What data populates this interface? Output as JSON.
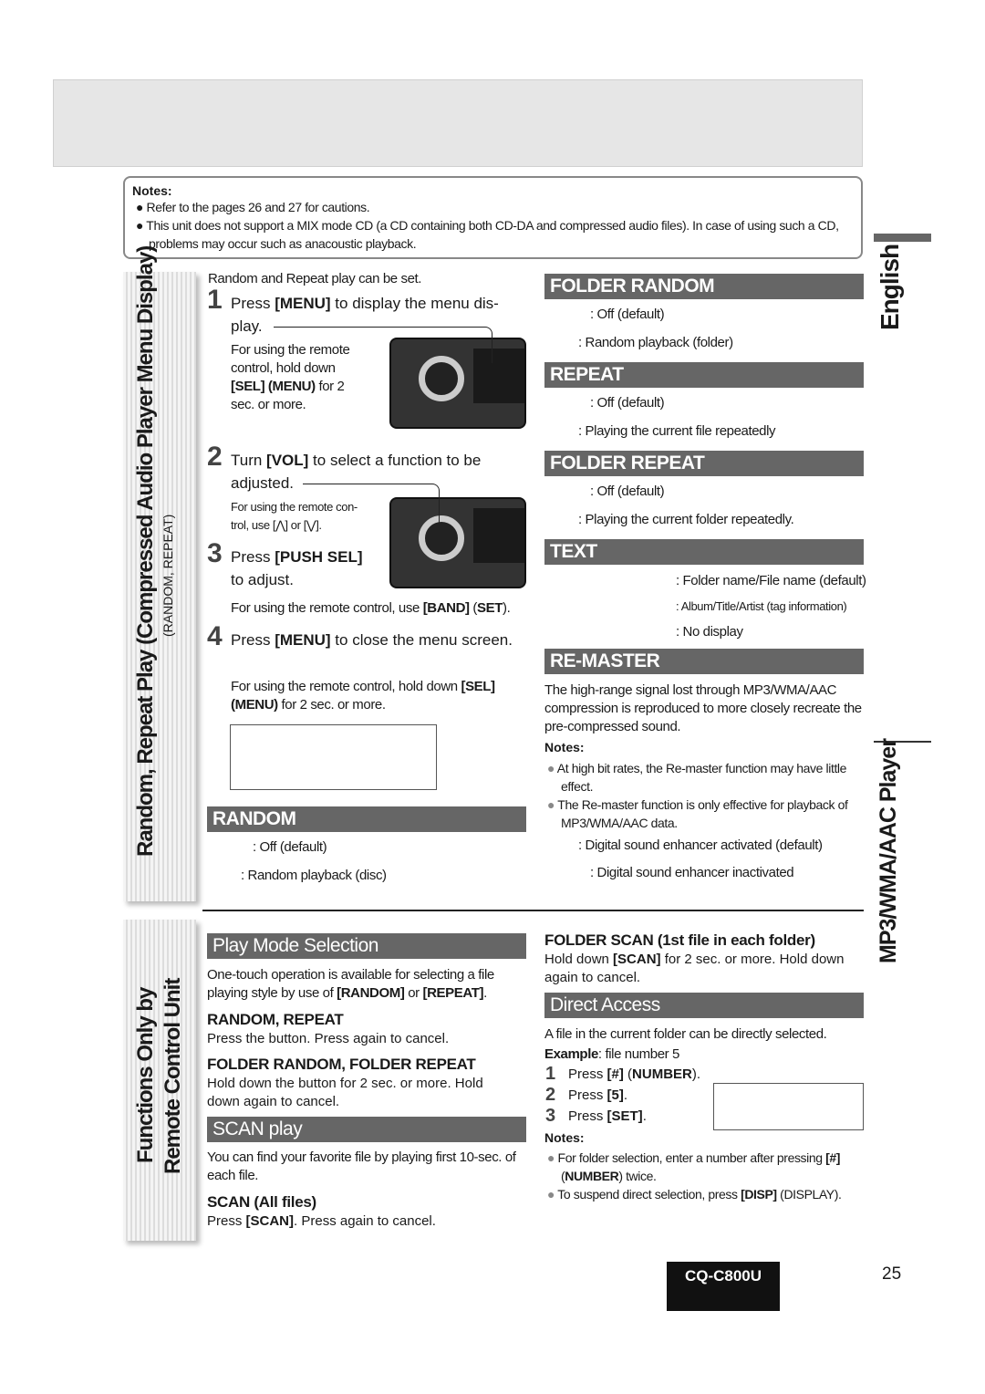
{
  "notes_top": {
    "title": "Notes:",
    "items": [
      "Refer to the pages 26 and 27 for cautions.",
      "This unit does not support a MIX mode CD (a CD containing both CD-DA and compressed audio files). In case of using such a CD, problems may occur such as anacoustic playback."
    ]
  },
  "side": {
    "title1": "Random, Repeat Play (Compressed Audio Player Menu Display)",
    "sub1": "(RANDOM, REPEAT)",
    "title2a": "Functions Only by",
    "title2b": "Remote Control Unit",
    "lang": "English",
    "product": "MP3/WMA/AAC Player"
  },
  "intro": "Random and Repeat play can be set.",
  "steps": [
    {
      "n": "1",
      "pre": "Press ",
      "key": "[MENU]",
      "post": " to display the menu dis- play.",
      "note_pre": "For using the remote control, hold down ",
      "note_key": "[SEL] (MENU)",
      "note_post": " for 2 sec. or more."
    },
    {
      "n": "2",
      "pre": "Turn ",
      "key": "[VOL]",
      "post": " to select a function to be adjusted.",
      "note": "For using the remote con- trol, use [⋀] or [⋁]."
    },
    {
      "n": "3",
      "pre": "Press ",
      "key": "[PUSH SEL]",
      "post": " to adjust.",
      "note_pre": "For using the remote control, use ",
      "note_key": "[BAND]",
      "note_mid": " (",
      "note_key2": "SET",
      "note_post": ")."
    },
    {
      "n": "4",
      "pre": "Press ",
      "key": "[MENU]",
      "post": " to close the menu screen.",
      "note_pre": "For using the remote control, hold down ",
      "note_key": "[SEL] (MENU)",
      "note_post": " for 2 sec. or more."
    }
  ],
  "random": {
    "title": "RANDOM",
    "opts": [
      ": Off (default)",
      ": Random playback (disc)"
    ]
  },
  "folder_random": {
    "title": "FOLDER RANDOM",
    "opts": [
      ": Off (default)",
      ": Random playback (folder)"
    ]
  },
  "repeat": {
    "title": "REPEAT",
    "opts": [
      ": Off (default)",
      ": Playing the current file repeatedly"
    ]
  },
  "folder_repeat": {
    "title": "FOLDER REPEAT",
    "opts": [
      ": Off (default)",
      ": Playing the current folder repeatedly."
    ]
  },
  "text": {
    "title": "TEXT",
    "opts": [
      ": Folder name/File name (default)",
      ": Album/Title/Artist (tag information)",
      ": No display"
    ]
  },
  "remaster": {
    "title": "RE-MASTER",
    "desc": "The high-range signal lost through MP3/WMA/AAC compression is reproduced to more closely recreate the pre-compressed sound.",
    "notes_title": "Notes:",
    "notes": [
      "At high bit rates, the Re-master function may have little effect.",
      "The Re-master function is only effective for playback of MP3/WMA/AAC data."
    ],
    "opts": [
      ": Digital sound enhancer activated (default)",
      ": Digital sound enhancer inactivated"
    ]
  },
  "play_mode": {
    "title": "Play Mode Selection",
    "desc_pre": "One-touch operation is available for selecting a file playing style by use of ",
    "k1": "[RANDOM]",
    "mid": " or ",
    "k2": "[REPEAT]",
    "desc_post": ".",
    "s1": "RANDOM, REPEAT",
    "s1_text": "Press the button. Press again to cancel.",
    "s2": "FOLDER RANDOM, FOLDER REPEAT",
    "s2_text": "Hold down the button for 2 sec. or more. Hold down again to cancel."
  },
  "scan": {
    "title": "SCAN play",
    "desc": "You can find your favorite file by playing first 10-sec. of each file.",
    "s1": "SCAN (All files)",
    "s1_pre": "Press ",
    "s1_key": "[SCAN]",
    "s1_post": ". Press again to cancel.",
    "s2": "FOLDER SCAN (1st file in each folder)",
    "s2_pre": "Hold down ",
    "s2_key": "[SCAN]",
    "s2_post": " for 2 sec. or more. Hold down again to cancel."
  },
  "direct": {
    "title": "Direct Access",
    "desc": "A file in the current folder can be directly selected.",
    "ex_label": "Example",
    "ex_text": ": file number 5",
    "steps": [
      {
        "n": "1",
        "pre": "Press ",
        "key": "[#]",
        "mid": " (",
        "key2": "NUMBER",
        "post": ")."
      },
      {
        "n": "2",
        "pre": "Press ",
        "key": "[5]",
        "post": "."
      },
      {
        "n": "3",
        "pre": "Press ",
        "key": "[SET]",
        "post": "."
      }
    ],
    "notes_title": "Notes:",
    "n1_pre": "For folder selection, enter a number after pressing ",
    "n1_key": "[#]",
    "n1_mid": " (",
    "n1_key2": "NUMBER",
    "n1_post": ") twice.",
    "n2_pre": "To suspend direct selection, press ",
    "n2_key": "[DISP]",
    "n2_post": " (DISPLAY)."
  },
  "footer": {
    "model": "CQ-C800U",
    "page": "25"
  }
}
